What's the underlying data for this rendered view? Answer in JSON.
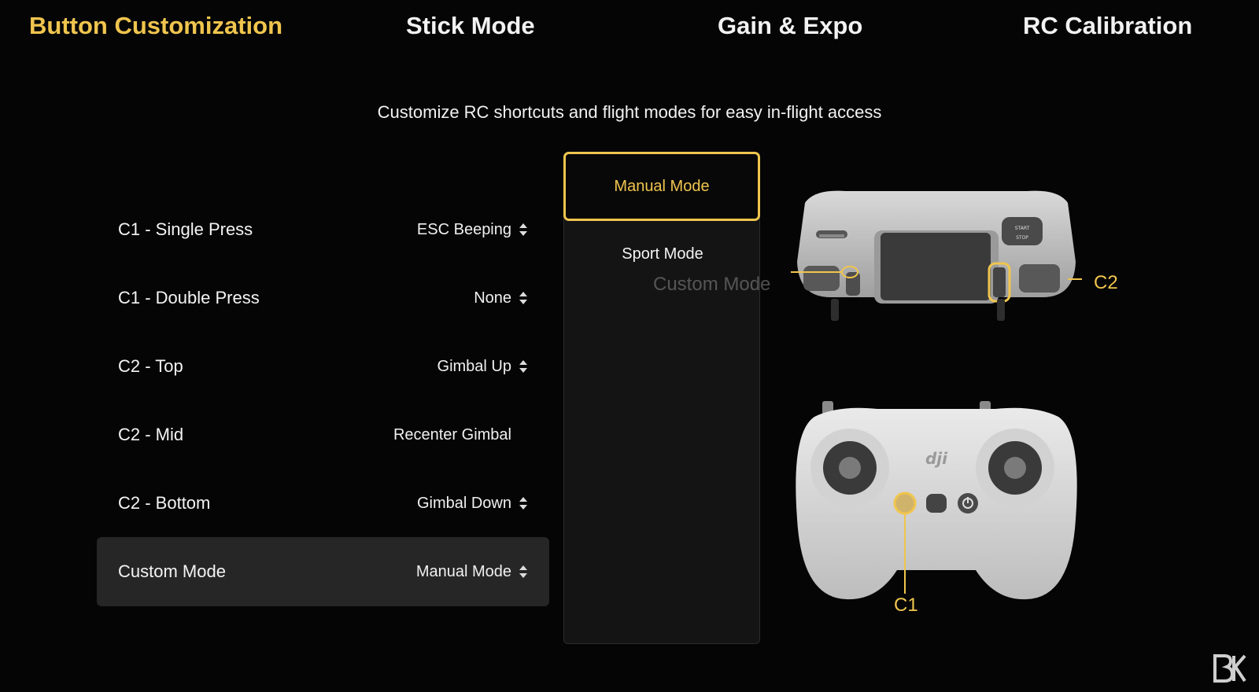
{
  "tabs": [
    {
      "label": "Button Customization",
      "active": true
    },
    {
      "label": "Stick Mode",
      "active": false
    },
    {
      "label": "Gain & Expo",
      "active": false
    },
    {
      "label": "RC Calibration",
      "active": false
    }
  ],
  "subtitle": "Customize RC shortcuts and flight modes for easy in-flight access",
  "settings": [
    {
      "label": "C1 - Single Press",
      "value": "ESC Beeping",
      "spinner": true
    },
    {
      "label": "C1 - Double Press",
      "value": "None",
      "spinner": true
    },
    {
      "label": "C2 - Top",
      "value": "Gimbal Up",
      "spinner": true
    },
    {
      "label": "C2 - Mid",
      "value": "Recenter Gimbal",
      "spinner": false
    },
    {
      "label": "C2 - Bottom",
      "value": "Gimbal Down",
      "spinner": true
    },
    {
      "label": "Custom Mode",
      "value": "Manual Mode",
      "spinner": true,
      "selected": true
    }
  ],
  "dropdown": {
    "options": [
      {
        "label": "Manual Mode",
        "selected": true
      },
      {
        "label": "Sport Mode",
        "selected": false
      }
    ]
  },
  "annotations": {
    "custom_mode": "Custom Mode",
    "c2": "C2",
    "c1": "C1"
  },
  "controller": {
    "top_buttons": [
      "START",
      "STOP"
    ],
    "brand": "dji"
  },
  "colors": {
    "accent": "#f0c54e",
    "background": "#050505",
    "selected_row": "#262626",
    "dropdown_bg": "#141414"
  },
  "icons": [
    "dropdown-spinner-icon",
    "power-icon",
    "watermark-logo-icon"
  ]
}
